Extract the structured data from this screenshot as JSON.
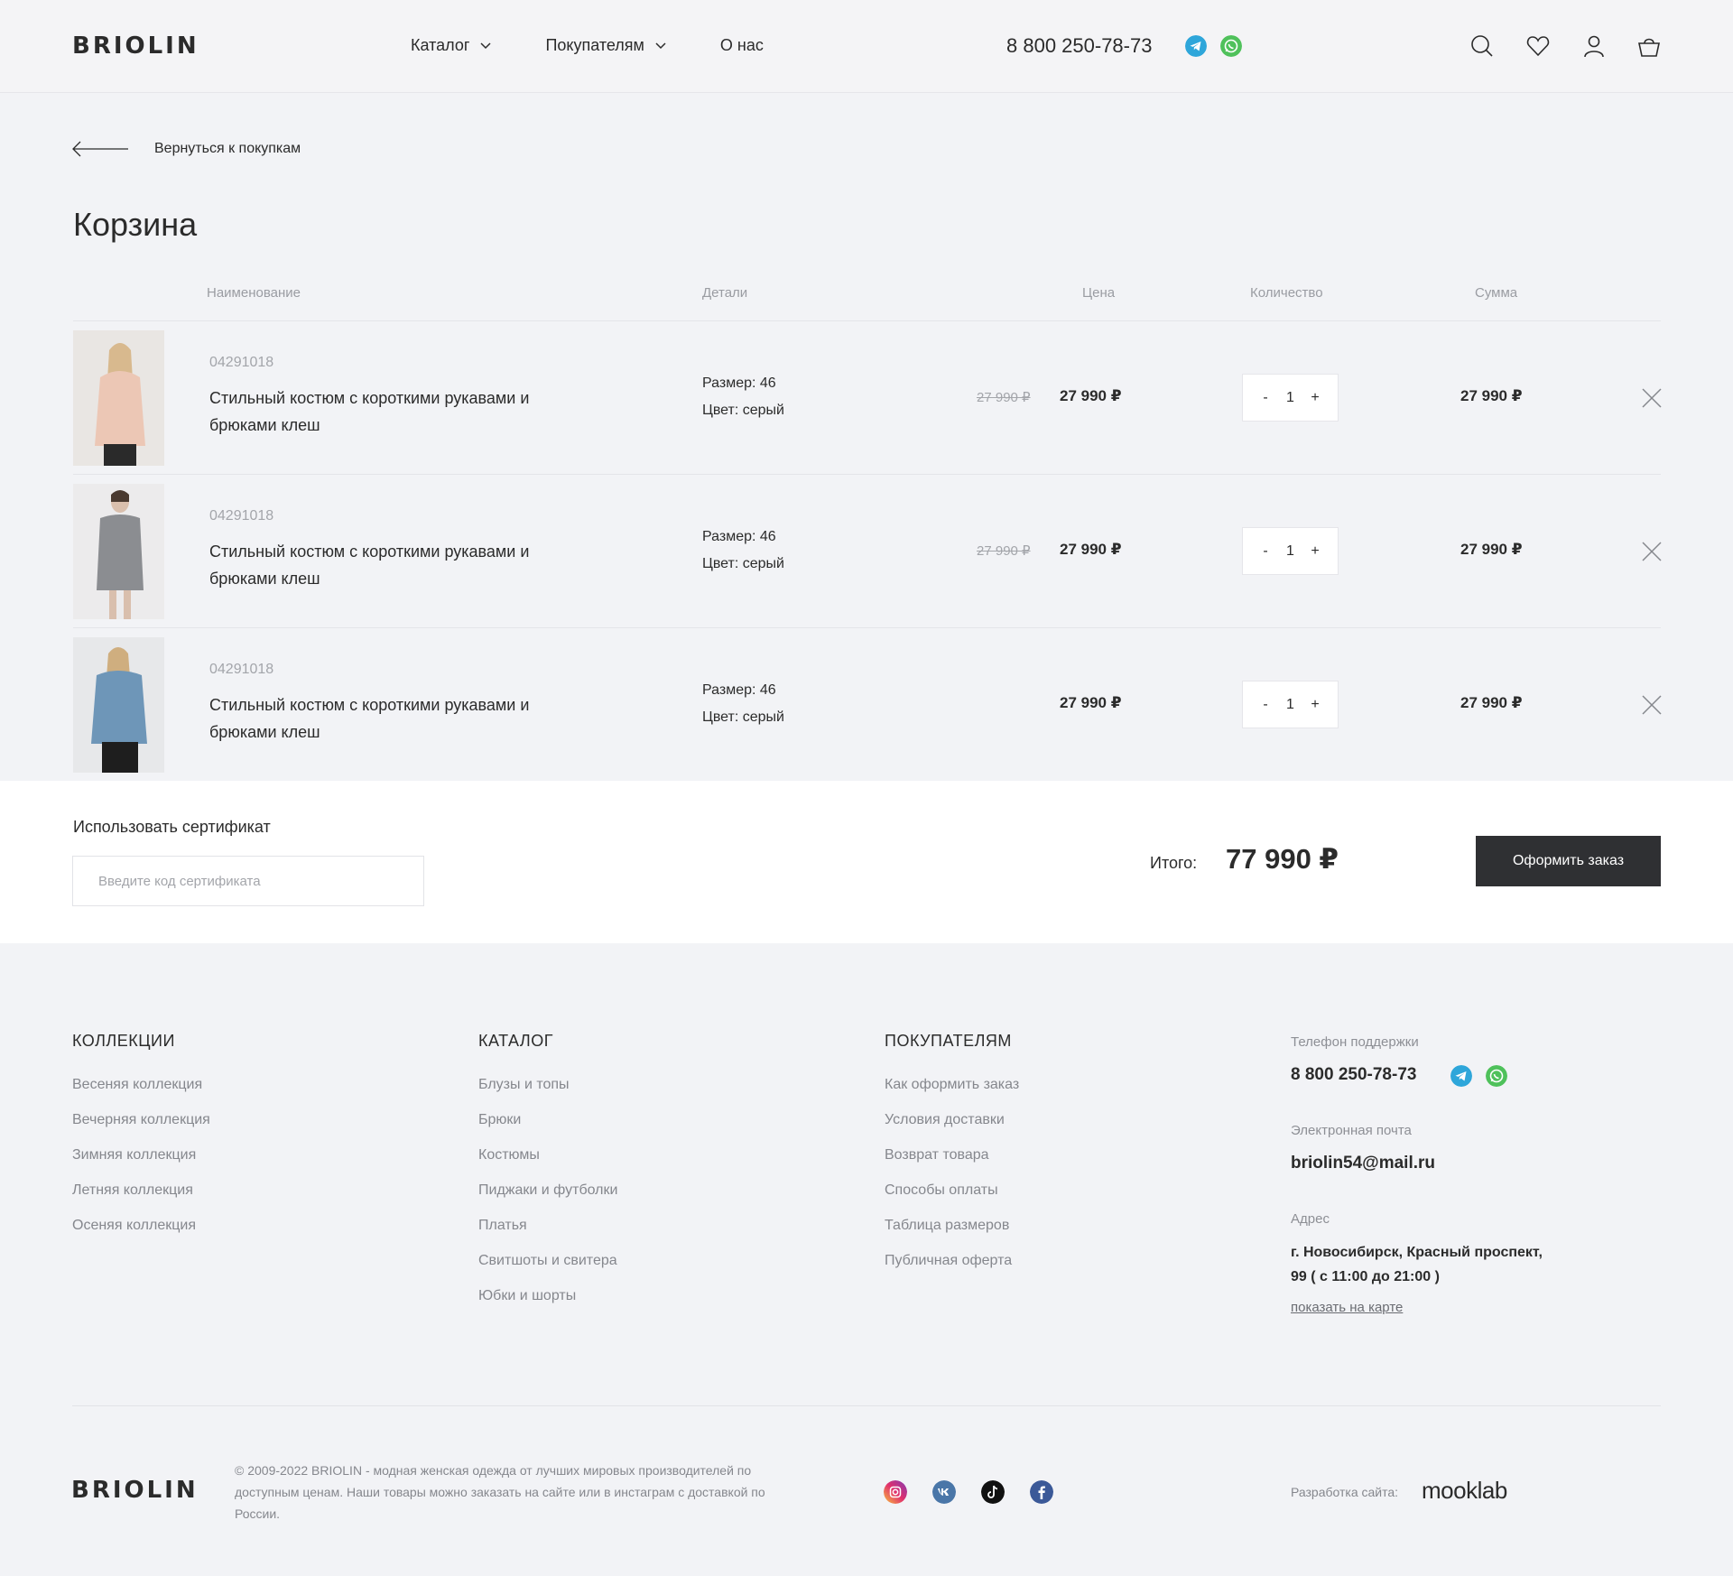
{
  "header": {
    "logo": "BRIOLIN",
    "nav": [
      {
        "label": "Каталог"
      },
      {
        "label": "Покупателям"
      },
      {
        "label": "О нас"
      }
    ],
    "phone": "8 800 250-78-73",
    "icons": [
      "telegram-icon",
      "whatsapp-icon",
      "search-icon",
      "heart-icon",
      "user-icon",
      "basket-icon"
    ]
  },
  "back_link": "Вернуться к покупкам",
  "page_title": "Корзина",
  "table": {
    "headers": [
      "Наименование",
      "Детали",
      "Цена",
      "Количество",
      "Сумма"
    ],
    "rows": [
      {
        "sku": "04291018",
        "name": "Стильный костюм с короткими рукавами и брюками клеш",
        "size": "Размер: 46",
        "color": "Цвет: серый",
        "old_price": "27 990 ₽",
        "price": "27 990 ₽",
        "qty": "1",
        "qty_minus": "-",
        "qty_plus": "+",
        "sum": "27 990 ₽"
      },
      {
        "sku": "04291018",
        "name": "Стильный костюм с короткими рукавами и брюками клеш",
        "size": "Размер: 46",
        "color": "Цвет: серый",
        "old_price": "27 990 ₽",
        "price": "27 990 ₽",
        "qty": "1",
        "qty_minus": "-",
        "qty_plus": "+",
        "sum": "27 990 ₽"
      },
      {
        "sku": "04291018",
        "name": "Стильный костюм с короткими рукавами и брюками клеш",
        "size": "Размер: 46",
        "color": "Цвет: серый",
        "old_price": "",
        "price": "27 990 ₽",
        "qty": "1",
        "qty_minus": "-",
        "qty_plus": "+",
        "sum": "27 990 ₽"
      }
    ]
  },
  "summary": {
    "cert_label": "Использовать сертификат",
    "cert_placeholder": "Введите код сертификата",
    "total_label": "Итого:",
    "total_value": "77 990 ₽",
    "order_button": "Оформить заказ"
  },
  "footer": {
    "columns": [
      {
        "title": "КОЛЛЕКЦИИ",
        "items": [
          "Весеняя коллекция",
          "Вечерняя коллекция",
          "Зимняя коллекция",
          "Летняя коллекция",
          "Осеняя коллекция"
        ]
      },
      {
        "title": "КАТАЛОГ",
        "items": [
          "Блузы и топы",
          "Брюки",
          "Костюмы",
          "Пиджаки и футболки",
          "Платья",
          "Свитшоты и свитера",
          "Юбки и шорты"
        ]
      },
      {
        "title": "ПОКУПАТЕЛЯМ",
        "items": [
          "Как оформить заказ",
          "Условия доставки",
          "Возврат товара",
          "Способы оплаты",
          "Таблица размеров",
          "Публичная оферта"
        ]
      }
    ],
    "contacts": {
      "phone_label": "Телефон поддержки",
      "phone": "8 800 250-78-73",
      "email_label": "Электронная почта",
      "email": "briolin54@mail.ru",
      "address_label": "Адрес",
      "address": "г. Новосибирск, Красный проспект, 99 ( с 11:00 до 21:00 )",
      "map_link": "показать на карте"
    },
    "logo": "BRIOLIN",
    "copyright": "© 2009-2022 BRIOLIN - модная женская одежда от лучших мировых производителей по доступным ценам. Наши товары можно заказать на сайте или в инстаграм с доставкой по России.",
    "social": [
      "instagram-icon",
      "vk-icon",
      "tiktok-icon",
      "facebook-icon"
    ],
    "dev_label": "Разработка сайта:",
    "dev_logo": "mooklab"
  },
  "colors": {
    "page_bg": "#f2f3f6",
    "text": "#2b2b2b",
    "muted": "#85878d",
    "button": "#2f3033",
    "telegram": "#2ea6da",
    "whatsapp": "#4fc15b"
  }
}
